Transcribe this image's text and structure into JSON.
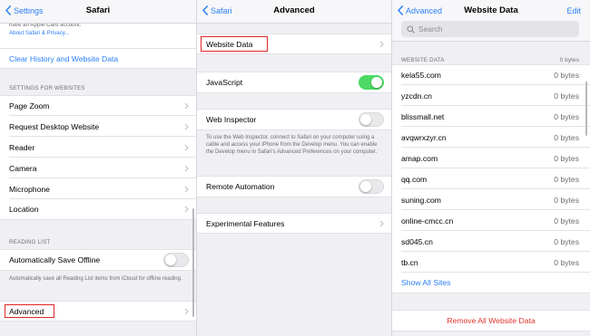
{
  "safari_panel": {
    "back_label": "Settings",
    "title": "Safari",
    "top_note_line1": "have an Apple Card account.",
    "top_note_link": "About Safari & Privacy...",
    "clear_history_label": "Clear History and Website Data",
    "settings_for_websites_header": "SETTINGS FOR WEBSITES",
    "website_items": [
      "Page Zoom",
      "Request Desktop Website",
      "Reader",
      "Camera",
      "Microphone",
      "Location"
    ],
    "reading_list_header": "READING LIST",
    "auto_save_label": "Automatically Save Offline",
    "auto_save_on": false,
    "auto_save_footnote": "Automatically save all Reading List items from iCloud for offline reading.",
    "advanced_label": "Advanced"
  },
  "advanced_panel": {
    "back_label": "Safari",
    "title": "Advanced",
    "website_data_label": "Website Data",
    "javascript_label": "JavaScript",
    "javascript_on": true,
    "web_inspector_label": "Web Inspector",
    "web_inspector_on": false,
    "web_inspector_footnote": "To use the Web Inspector, connect to Safari on your computer using a cable and access your iPhone from the Develop menu. You can enable the Develop menu in Safari's Advanced Preferences on your computer.",
    "remote_automation_label": "Remote Automation",
    "remote_automation_on": false,
    "experimental_label": "Experimental Features"
  },
  "website_data_panel": {
    "back_label": "Advanced",
    "title": "Website Data",
    "edit_label": "Edit",
    "search_placeholder": "Search",
    "section_header": "WEBSITE DATA",
    "section_total": "0 bytes",
    "sites": [
      {
        "name": "kela55.com",
        "size": "0 bytes"
      },
      {
        "name": "yzcdn.cn",
        "size": "0 bytes"
      },
      {
        "name": "blissmall.net",
        "size": "0 bytes"
      },
      {
        "name": "avqwrxzyr.cn",
        "size": "0 bytes"
      },
      {
        "name": "amap.com",
        "size": "0 bytes"
      },
      {
        "name": "qq.com",
        "size": "0 bytes"
      },
      {
        "name": "suning.com",
        "size": "0 bytes"
      },
      {
        "name": "online-cmcc.cn",
        "size": "0 bytes"
      },
      {
        "name": "sd045.cn",
        "size": "0 bytes"
      },
      {
        "name": "tb.cn",
        "size": "0 bytes"
      }
    ],
    "show_all_label": "Show All Sites",
    "remove_all_label": "Remove All Website Data"
  },
  "colors": {
    "accent": "#2a7ff6",
    "destructive": "#e0342f",
    "toggle_on": "#4cd964",
    "highlight_box": "#e0252a",
    "grouped_background": "#efeff4"
  }
}
